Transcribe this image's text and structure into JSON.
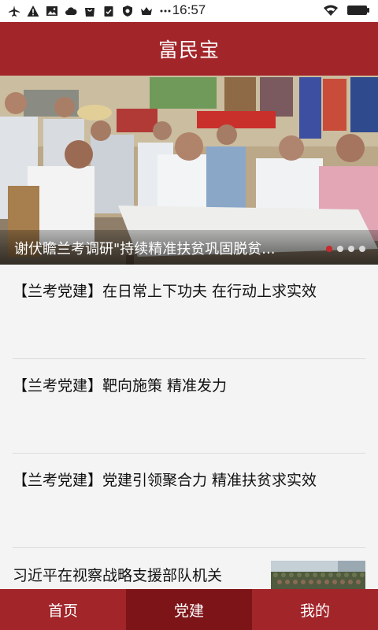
{
  "status_bar": {
    "time": "16:57",
    "left_icons": [
      "airplane-icon",
      "warning-icon",
      "image-icon",
      "cloud-icon",
      "shopping-bag-icon",
      "clipboard-check-icon",
      "shield-icon",
      "crown-icon",
      "more-dots-icon"
    ],
    "right_icons": [
      "wifi-icon",
      "battery-icon"
    ]
  },
  "header": {
    "title": "富民宝",
    "color": "#a2252a"
  },
  "banner": {
    "caption": "谢伏瞻兰考调研\"持续精准扶贫巩固脱贫...",
    "slide_count": 4,
    "active_slide": 0
  },
  "news": [
    {
      "title": "【兰考党建】在日常上下功夫  在行动上求实效"
    },
    {
      "title": "【兰考党建】靶向施策  精准发力"
    },
    {
      "title": "【兰考党建】党建引领聚合力  精准扶贫求实效"
    },
    {
      "title": "习近平在视察战略支援部队机关",
      "has_thumbnail": true
    }
  ],
  "bottom_nav": {
    "tabs": [
      {
        "label": "首页",
        "active": false
      },
      {
        "label": "党建",
        "active": true
      },
      {
        "label": "我的",
        "active": false
      }
    ]
  }
}
